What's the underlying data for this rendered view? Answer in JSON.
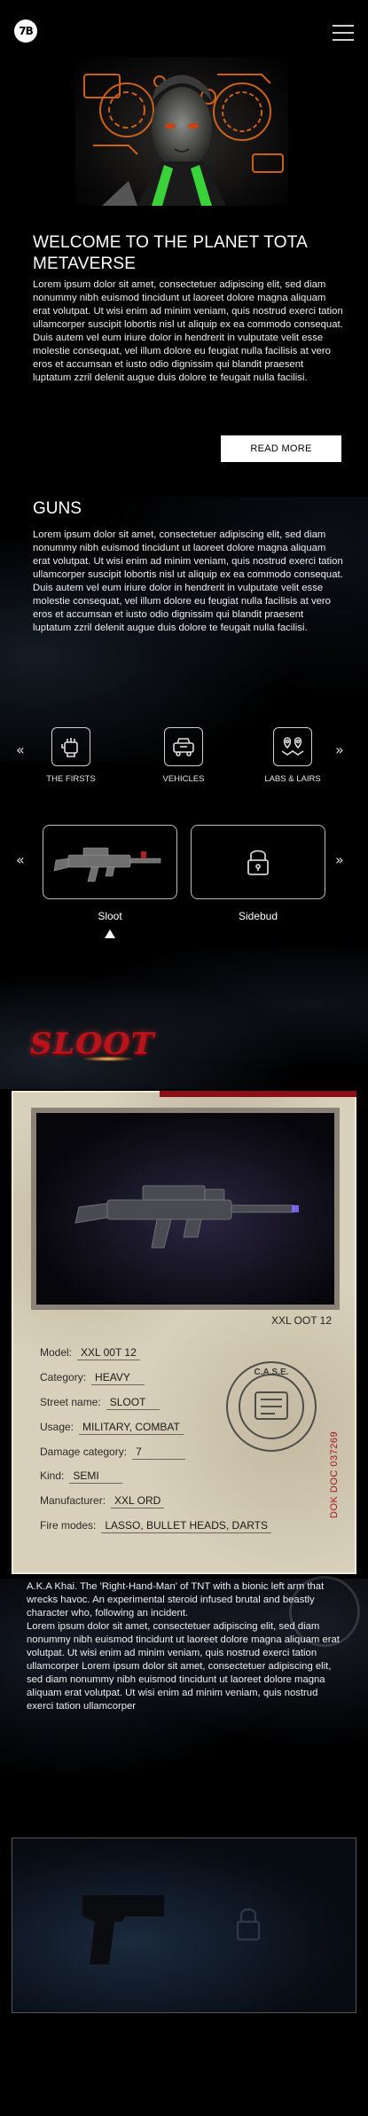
{
  "header": {
    "logo_text": "7B",
    "menu_icon": "hamburger-icon"
  },
  "hero": {
    "title": "WELCOME TO THE PLANET TOTA METAVERSE",
    "body": "Lorem ipsum dolor sit amet, consectetuer adipiscing elit, sed diam nonummy nibh euismod tincidunt ut laoreet dolore magna aliquam erat volutpat. Ut wisi enim ad minim veniam, quis nostrud exerci tation ullamcorper suscipit lobortis nisl ut aliquip ex ea commodo consequat. Duis autem vel eum iriure dolor in hendrerit in vulputate velit esse molestie consequat, vel illum dolore eu feugiat nulla facilisis at vero eros et accumsan et iusto odio dignissim qui blandit praesent luptatum zzril delenit augue duis dolore te feugait nulla facilisi.",
    "read_more": "READ MORE"
  },
  "guns": {
    "title": "GUNS",
    "body": "Lorem ipsum dolor sit amet, consectetuer adipiscing elit, sed diam nonummy nibh euismod tincidunt ut laoreet dolore magna aliquam erat volutpat. Ut wisi enim ad minim veniam, quis nostrud exerci tation ullamcorper suscipit lobortis nisl ut aliquip ex ea commodo consequat. Duis autem vel eum iriure dolor in hendrerit in vulputate velit esse molestie consequat, vel illum dolore eu feugiat nulla facilisis at vero eros et accumsan et iusto odio dignissim qui blandit praesent luptatum zzril delenit augue duis dolore te feugait nulla facilisi.",
    "categories": [
      {
        "label": "THE FIRSTS",
        "icon": "fist-icon"
      },
      {
        "label": "VEHICLES",
        "icon": "vehicle-icon"
      },
      {
        "label": "LABS & LAIRS",
        "icon": "map-pins-icon"
      }
    ],
    "weapons": [
      {
        "label": "Sloot",
        "icon": "rifle-icon",
        "selected": true
      },
      {
        "label": "Sidebud",
        "icon": "lock-icon",
        "selected": false
      }
    ]
  },
  "dossier": {
    "banner": "SLOOT",
    "caption": "XXL OOT 12",
    "stamp": "C.A.S.E.",
    "doc_code": "DOK DOC 037269",
    "fields": [
      {
        "key": "Model:",
        "value": "XXL 00T 12"
      },
      {
        "key": "Category:",
        "value": "HEAVY"
      },
      {
        "key": "Street name:",
        "value": "SLOOT"
      },
      {
        "key": "Usage:",
        "value": "MILITARY, COMBAT"
      },
      {
        "key": "Damage category:",
        "value": "7"
      },
      {
        "key": "Kind:",
        "value": "SEMI"
      },
      {
        "key": "Manufacturer:",
        "value": "XXL ORD"
      },
      {
        "key": "Fire modes:",
        "value": "LASSO, BULLET HEADS, DARTS"
      }
    ]
  },
  "bio": {
    "intro": "A.K.A Khai. The 'Right-Hand-Man' of TNT with a bionic left arm that wrecks havoc. An experimental steroid infused brutal and beastly character who, following an incident.",
    "body": "Lorem ipsum dolor sit amet, consectetuer adipiscing elit, sed diam nonummy nibh euismod tincidunt ut laoreet dolore magna aliquam erat volutpat. Ut wisi enim ad minim veniam, quis nostrud exerci tation ullamcorper Lorem ipsum dolor sit amet, consectetuer adipiscing elit, sed diam nonummy nibh euismod tincidunt ut laoreet dolore magna aliquam erat volutpat. Ut wisi enim ad minim veniam, quis nostrud exerci tation ullamcorper"
  },
  "colors": {
    "accent_red": "#b8141c",
    "paper": "#d8d0bb",
    "background": "#000000"
  }
}
